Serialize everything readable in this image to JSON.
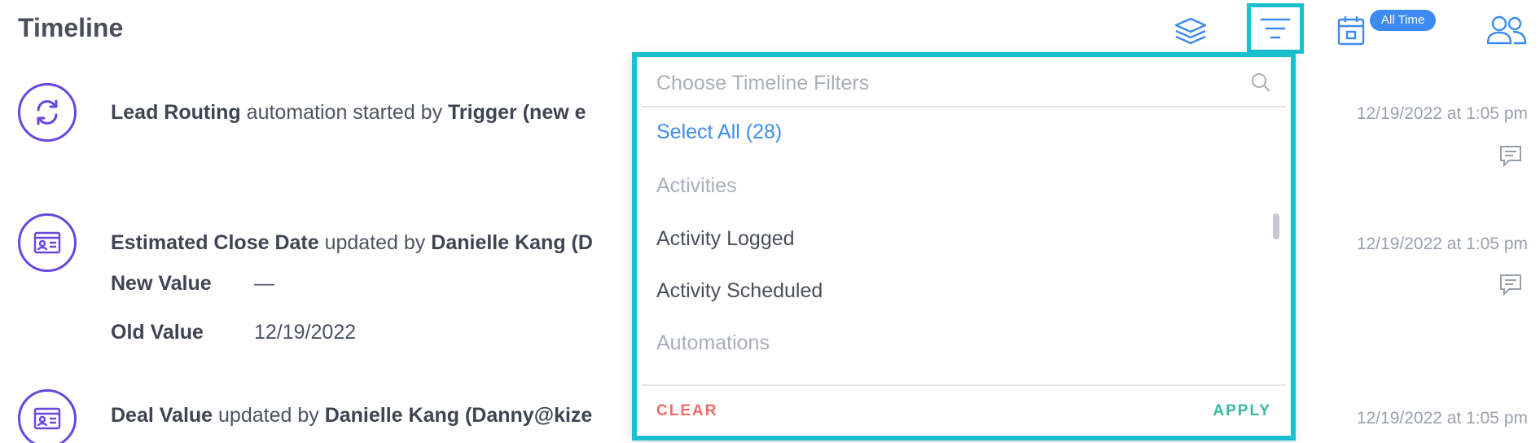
{
  "header": {
    "title": "Timeline",
    "date_filter_badge": "All Time"
  },
  "timeline": [
    {
      "icon": "refresh-icon",
      "bold1": "Lead Routing",
      "text1": " automation started by ",
      "bold2": "Trigger (new e",
      "timestamp": "12/19/2022 at 1:05 pm"
    },
    {
      "icon": "contact-card-icon",
      "bold1": "Estimated Close Date",
      "text1": " updated by ",
      "bold2": "Danielle Kang (D",
      "timestamp": "12/19/2022 at 1:05 pm",
      "new_value_label": "New Value",
      "new_value": "—",
      "old_value_label": "Old Value",
      "old_value": "12/19/2022"
    },
    {
      "icon": "contact-card-icon",
      "bold1": "Deal Value",
      "text1": " updated by ",
      "bold2": "Danielle Kang (Danny@kize",
      "timestamp": "12/19/2022 at 1:05 pm"
    }
  ],
  "filter_panel": {
    "search_placeholder": "Choose Timeline Filters",
    "select_all": "Select All (28)",
    "group_activities": "Activities",
    "option_activity_logged": "Activity Logged",
    "option_activity_scheduled": "Activity Scheduled",
    "group_automations": "Automations",
    "clear_label": "CLEAR",
    "apply_label": "APPLY"
  },
  "colors": {
    "accent_cyan": "#1ac0d0",
    "link_blue": "#3d8bf2",
    "avatar_purple": "#6b45e0",
    "clear_red": "#f06a6a",
    "apply_green": "#38b9a0"
  }
}
